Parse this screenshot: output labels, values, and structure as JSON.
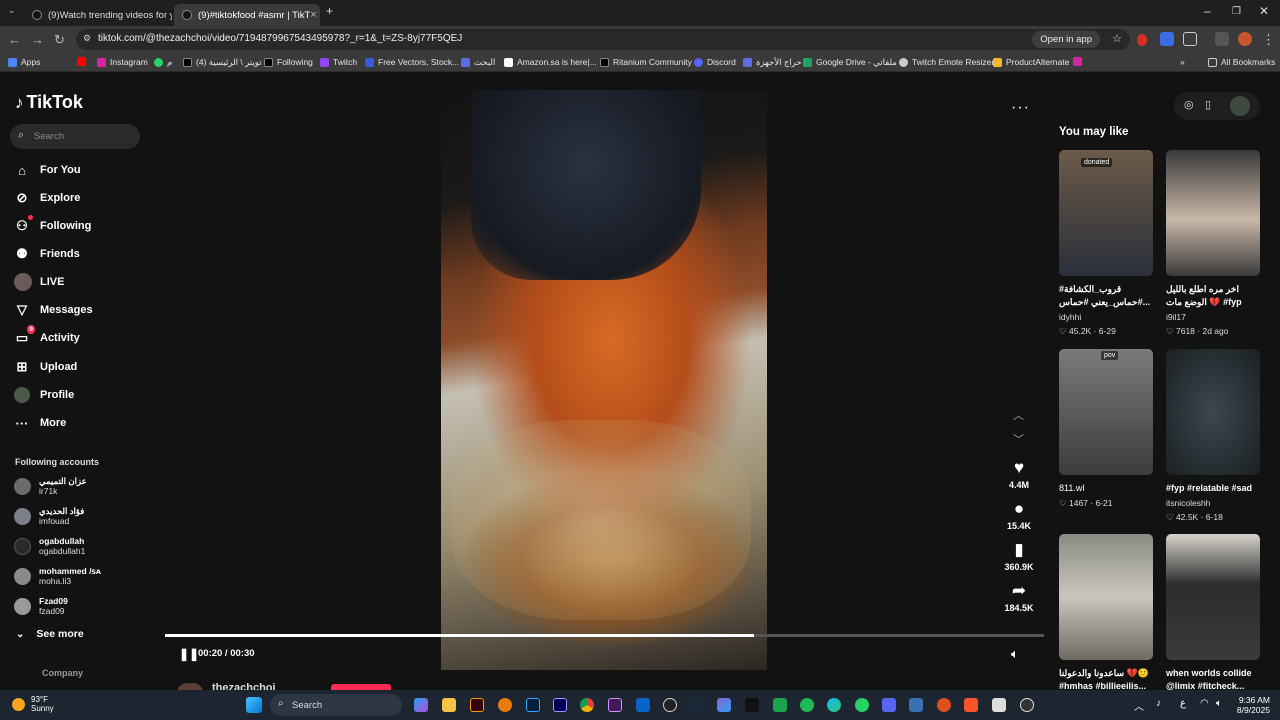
{
  "browser": {
    "tabs": [
      {
        "title": "(9)Watch trending videos for yo",
        "active": false
      },
      {
        "title": "(9)#tiktokfood #asmr | TikT",
        "active": true
      }
    ],
    "url": "tiktok.com/@thezachchoi/video/7194879967543495978?_r=1&_t=ZS-8yj77F5QEJ",
    "open_in_app": "Open in app",
    "bookmarks": [
      "Apps",
      "Instagram",
      "م",
      "تويتر \\ الرئيسية (4)",
      "Following",
      "Twitch",
      "Free Vectors, Stock...",
      "البحث",
      "Amazon.sa is here|...",
      "Ritanium Community",
      "Discord",
      "حراج الأجهزة",
      "Google Drive - ملفاتي",
      "Twitch Emote Resizer",
      "ProductAlternate"
    ],
    "all_bookmarks": "All Bookmarks"
  },
  "sidebar": {
    "logo": "TikTok",
    "search_placeholder": "Search",
    "nav": [
      {
        "label": "For You",
        "icon": "home-icon"
      },
      {
        "label": "Explore",
        "icon": "compass-icon"
      },
      {
        "label": "Following",
        "icon": "following-icon"
      },
      {
        "label": "Friends",
        "icon": "friends-icon"
      },
      {
        "label": "LIVE",
        "icon": "live-icon"
      },
      {
        "label": "Messages",
        "icon": "messages-icon"
      },
      {
        "label": "Activity",
        "icon": "activity-icon",
        "badge": "9"
      },
      {
        "label": "Upload",
        "icon": "upload-icon"
      },
      {
        "label": "Profile",
        "icon": "profile-icon"
      },
      {
        "label": "More",
        "icon": "more-icon"
      }
    ],
    "following_title": "Following accounts",
    "accounts": [
      {
        "name": "عزان التميمي",
        "handle": "ir71k",
        "color": "#6b6b6b"
      },
      {
        "name": "فؤاد الحديدي",
        "handle": "imfouad",
        "color": "#7a7f88"
      },
      {
        "name": "ogabdullah",
        "handle": "ogabdullah1",
        "color": "#2a2a2a"
      },
      {
        "name": "mohammed /ꜱᴀ",
        "handle": "moha.li3",
        "color": "#8a8a8a"
      },
      {
        "name": "Fzad09",
        "handle": "fzad09",
        "color": "#9a9a9a"
      }
    ],
    "see_more": "See more",
    "company": "Company"
  },
  "player": {
    "time": "00:20 / 00:30",
    "progress": 0.67,
    "creator": "thezachchoi",
    "actions": [
      {
        "name": "like",
        "icon": "heart-icon",
        "count": "4.4M"
      },
      {
        "name": "comment",
        "icon": "comment-icon",
        "count": "15.4K"
      },
      {
        "name": "save",
        "icon": "bookmark-icon",
        "count": "360.9K"
      },
      {
        "name": "share",
        "icon": "share-icon",
        "count": "184.5K"
      }
    ]
  },
  "right_panel": {
    "title": "You may like",
    "videos": [
      {
        "caption": "قروب_الكشافة# #حماس_يعني #حماس...",
        "user": "idyhhi",
        "likes": "45.2K",
        "date": "6-29",
        "thumb_text": "donated",
        "colors": [
          "#5a4a3a",
          "#2a2f3a"
        ]
      },
      {
        "caption": "اخر مره اطلع بالليل الوضع مات 💔 #fyp #foryo...",
        "user": "i9il17",
        "likes": "7618",
        "date": "2d ago",
        "thumb_text": "",
        "colors": [
          "#c9c3bd",
          "#3a3a3a"
        ]
      },
      {
        "caption": "811.wl",
        "user": "",
        "likes": "1467",
        "date": "6-21",
        "thumb_text": "pov",
        "colors": [
          "#6e6e6e",
          "#3c3c3c"
        ]
      },
      {
        "caption": "#fyp #relatable #sad",
        "user": "itsnicoleshh",
        "likes": "42.5K",
        "date": "6-18",
        "thumb_text": "",
        "colors": [
          "#2a3438",
          "#1a2024"
        ]
      },
      {
        "caption": "ساعدونا والدعولنا 💔🙂 #hmhas #billieeilis...",
        "user": "",
        "likes": "",
        "date": "",
        "thumb_text": "",
        "colors": [
          "#b9b7b0",
          "#6f6a62"
        ]
      },
      {
        "caption": "when worlds collide @limix #fitcheck...",
        "user": "",
        "likes": "",
        "date": "",
        "thumb_text": "",
        "colors": [
          "#d7d3cc",
          "#3a3a3a"
        ]
      }
    ]
  },
  "taskbar": {
    "temperature": "93°F",
    "condition": "Sunny",
    "search": "Search",
    "time": "9:36 AM",
    "date": "8/9/2025",
    "lang": "ع"
  }
}
